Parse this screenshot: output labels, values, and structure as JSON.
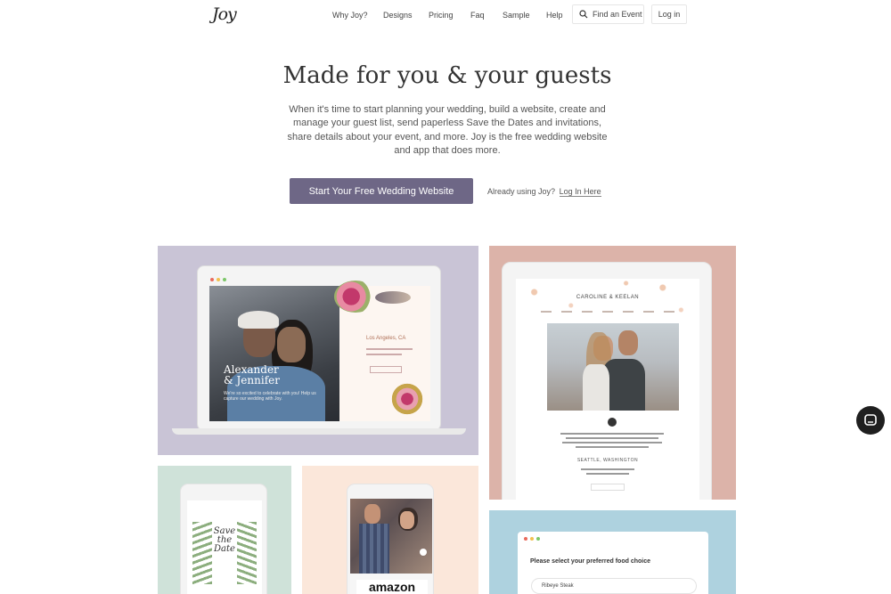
{
  "nav": {
    "logo": "Joy",
    "links": [
      "Why Joy?",
      "Designs",
      "Pricing",
      "Faq",
      "Sample",
      "Help"
    ],
    "search_label": "Find an Event",
    "login_label": "Log in"
  },
  "hero": {
    "title": "Made for you & your guests",
    "description": "When it's time to start planning your wedding, build a website, create and manage your guest list, send paperless Save the Dates and invitations, share details about your event, and more. Joy is the free wedding website and app that does more.",
    "cta_label": "Start Your Free Wedding Website",
    "already_text": "Already using Joy?",
    "login_link": "Log In Here"
  },
  "gallery": {
    "sample1": {
      "names": "Alexander\n& Jennifer",
      "tagline": "We're so excited to celebrate with you! Help us capture our wedding with Joy.",
      "location": "Los Angeles, CA"
    },
    "sample2": {
      "couple": "CAROLINE & KEELAN",
      "city": "SEATTLE, WASHINGTON"
    },
    "sample3": {
      "save_the_date": "Save\nthe\nDate"
    },
    "sample4": {
      "brand": "amazon"
    },
    "sample5": {
      "question": "Please select your preferred food choice",
      "option": "Ribeye Steak"
    }
  },
  "colors": {
    "cta": "#6e6786",
    "panel_lavender": "#c9c4d6",
    "panel_rose": "#dcb3a9",
    "panel_mint": "#cfe2d9",
    "panel_peach": "#fbe7da",
    "panel_blue": "#aed2df"
  },
  "icons": {
    "search": "search-icon",
    "chat": "chat-icon"
  }
}
